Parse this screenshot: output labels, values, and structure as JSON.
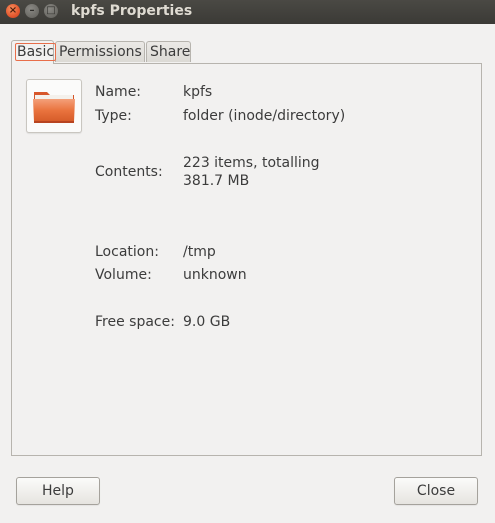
{
  "window": {
    "title": "kpfs Properties"
  },
  "controls": {
    "close_glyph": "×",
    "minimize_glyph": "–",
    "maximize_glyph": "□"
  },
  "tabs": [
    {
      "label": "Basic",
      "active": true
    },
    {
      "label": "Permissions",
      "active": false
    },
    {
      "label": "Share",
      "active": false
    }
  ],
  "icon": {
    "name": "folder-icon",
    "color": "#e2693a"
  },
  "fields": {
    "name": {
      "label": "Name:",
      "value": "kpfs"
    },
    "type": {
      "label": "Type:",
      "value": "folder (inode/directory)"
    },
    "contents": {
      "label": "Contents:",
      "value_line1": "223 items, totalling",
      "value_line2": "381.7 MB"
    },
    "location": {
      "label": "Location:",
      "value": "/tmp"
    },
    "volume": {
      "label": "Volume:",
      "value": "unknown"
    },
    "free_space": {
      "label": "Free space:",
      "value": "9.0 GB"
    }
  },
  "buttons": {
    "help": "Help",
    "close": "Close"
  }
}
